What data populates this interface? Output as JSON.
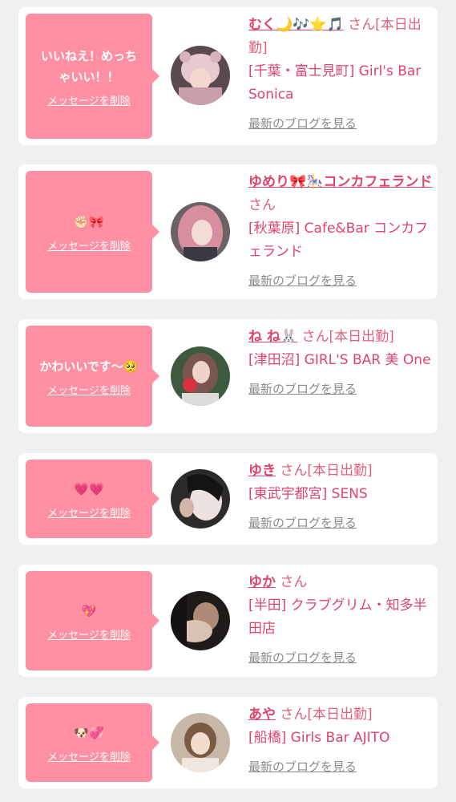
{
  "colors": {
    "bubble": "#ff8fa3",
    "accent": "#e0446b",
    "muted": "#8a8a8a",
    "page_bg": "#f0f0f2"
  },
  "delete_label": "メッセージを削除",
  "blog_label": "最新のブログを見る",
  "san": "さん",
  "cards": [
    {
      "message": "いいねえ！めっち\nゃいい！！",
      "name": "むく🌙🎶⭐🎵",
      "status": "[本日出勤]",
      "shop": "[千葉・富士見町] Girl's Bar Sonica"
    },
    {
      "message": "✊🏻🎀",
      "name": "ゆめり🎀🎠コンカフェランド",
      "status": "",
      "shop": "[秋葉原] Cafe&Bar コンカフェランド"
    },
    {
      "message": "かわいいです〜🥺",
      "name": "ね ね🐰",
      "status": "[本日出勤]",
      "shop": "[津田沼] GIRL'S BAR 美 One"
    },
    {
      "message": "💗💗",
      "name": "ゆき",
      "status": "[本日出勤]",
      "shop": "[東武宇都宮] SENS"
    },
    {
      "message": "💖",
      "name": "ゆか",
      "status": "",
      "shop": "[半田] クラブグリム・知多半田店"
    },
    {
      "message": "🐶💞",
      "name": "あや",
      "status": "[本日出勤]",
      "shop": "[船橋] Girls Bar AJITO"
    }
  ]
}
